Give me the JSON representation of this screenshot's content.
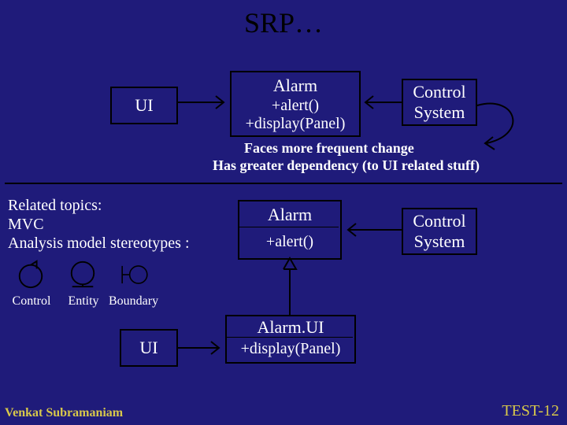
{
  "title": "SRP…",
  "top": {
    "ui": "UI",
    "alarm": {
      "name": "Alarm",
      "op1": "+alert()",
      "op2": "+display(Panel)"
    },
    "control": {
      "l1": "Control",
      "l2": "System"
    }
  },
  "notes": {
    "l1": "Faces more frequent change",
    "l2": "Has greater dependency (to UI related stuff)"
  },
  "related": {
    "heading": "Related topics:",
    "l1": "MVC",
    "l2": "Analysis model stereotypes :",
    "control": "Control",
    "entity": "Entity",
    "boundary": "Boundary"
  },
  "bottom": {
    "alarm": {
      "name": "Alarm",
      "op": "+alert()"
    },
    "control": {
      "l1": "Control",
      "l2": "System"
    },
    "ui": "UI",
    "alarmui": {
      "name": "Alarm.UI",
      "op": "+display(Panel)"
    }
  },
  "footer": {
    "author": "Venkat Subramaniam",
    "page": "TEST-12"
  }
}
